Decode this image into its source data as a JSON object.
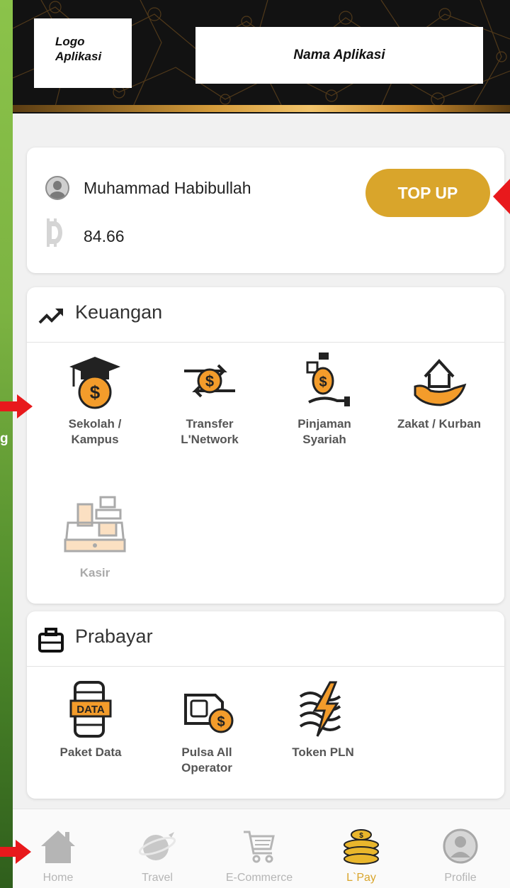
{
  "side_text": "g",
  "header": {
    "logo_text": "Logo\nAplikasi",
    "app_name": "Nama Aplikasi"
  },
  "user": {
    "name": "Muhammad Habibullah",
    "balance": "84.66",
    "topup_label": "TOP UP"
  },
  "keuangan": {
    "title": "Keuangan",
    "items": [
      {
        "label": "Sekolah /\nKampus",
        "icon": "graduation-cap-coin-icon"
      },
      {
        "label": "Transfer\nL'Network",
        "icon": "transfer-coin-icon"
      },
      {
        "label": "Pinjaman\nSyariah",
        "icon": "loan-hand-icon"
      },
      {
        "label": "Zakat / Kurban",
        "icon": "house-hand-icon"
      },
      {
        "label": "Kasir",
        "icon": "cash-register-icon"
      }
    ]
  },
  "prabayar": {
    "title": "Prabayar",
    "items": [
      {
        "label": "Paket Data",
        "icon": "phone-data-icon",
        "badge": "DATA"
      },
      {
        "label": "Pulsa All\nOperator",
        "icon": "sim-card-coin-icon"
      },
      {
        "label": "Token PLN",
        "icon": "lightning-token-icon"
      }
    ]
  },
  "nav": [
    {
      "label": "Home",
      "icon": "home-icon"
    },
    {
      "label": "Travel",
      "icon": "travel-globe-icon"
    },
    {
      "label": "E-Commerce",
      "icon": "cart-icon"
    },
    {
      "label": "L`Pay",
      "icon": "coins-stack-icon",
      "active": true
    },
    {
      "label": "Profile",
      "icon": "profile-icon"
    }
  ],
  "colors": {
    "accent": "#d9a52b",
    "orange": "#f39c2b",
    "arrow": "#e8191c",
    "green_bg": "#7cb342"
  }
}
